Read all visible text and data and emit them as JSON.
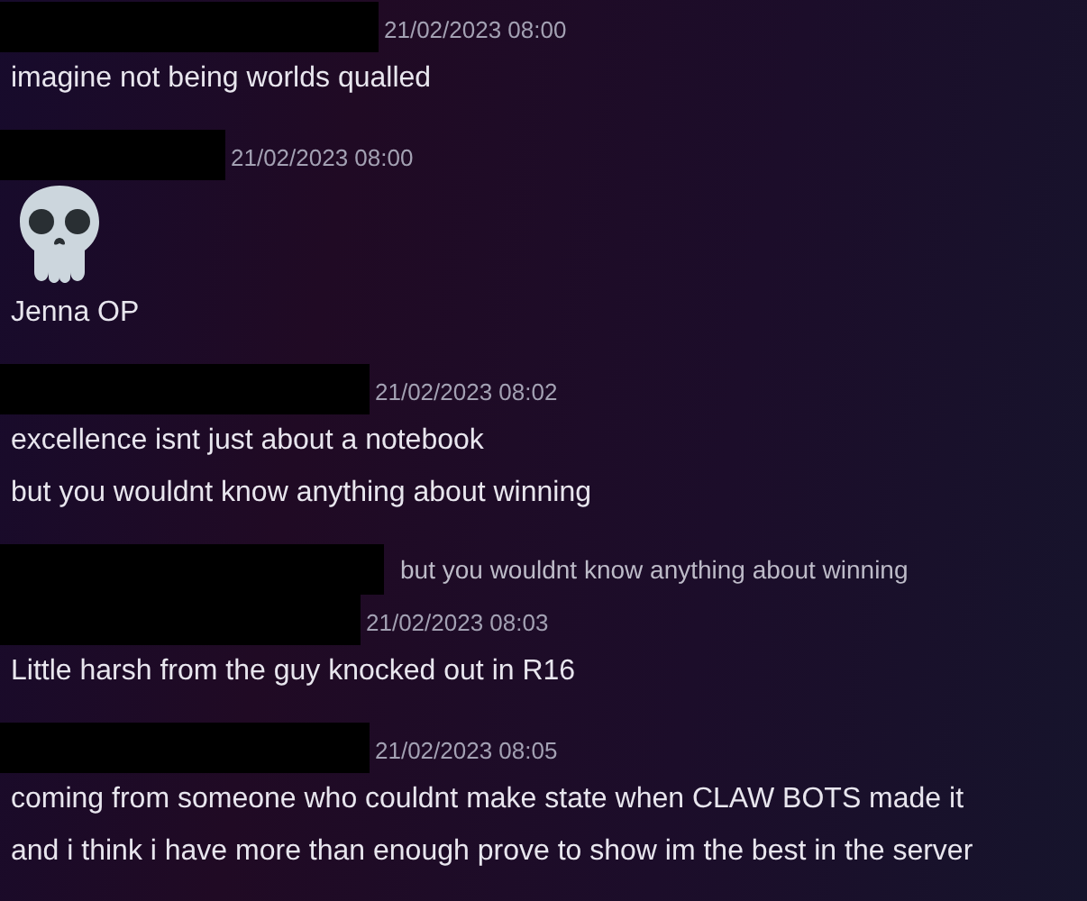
{
  "messages": [
    {
      "timestamp": "21/02/2023 08:00",
      "content": [
        {
          "kind": "text",
          "text": "imagine not being worlds qualled"
        }
      ]
    },
    {
      "timestamp": "21/02/2023 08:00",
      "content": [
        {
          "kind": "emoji"
        },
        {
          "kind": "text",
          "text": "Jenna OP"
        }
      ]
    },
    {
      "timestamp": "21/02/2023 08:02",
      "content": [
        {
          "kind": "text",
          "text": "excellence isnt just about a notebook"
        },
        {
          "kind": "text",
          "text": "but you wouldnt know anything about winning"
        }
      ]
    },
    {
      "reply": {
        "text": "but you wouldnt know anything about winning"
      },
      "timestamp": "21/02/2023 08:03",
      "content": [
        {
          "kind": "text",
          "text": "Little harsh from the guy knocked out in R16"
        }
      ]
    },
    {
      "timestamp": "21/02/2023 08:05",
      "content": [
        {
          "kind": "text",
          "text": "coming from someone who couldnt make state when CLAW BOTS made it"
        },
        {
          "kind": "text",
          "text": "and i think i have more than enough prove to show im the best in the server"
        }
      ]
    }
  ]
}
